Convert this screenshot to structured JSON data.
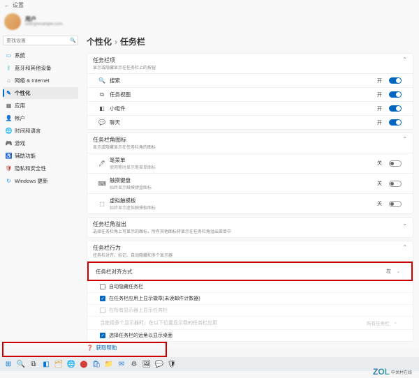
{
  "titlebar": {
    "back": "←",
    "title": "设置"
  },
  "profile": {
    "name": "用户",
    "email": "user@example.com"
  },
  "search": {
    "placeholder": "查找设置"
  },
  "nav": [
    {
      "icon": "▭",
      "iconClass": "c-blue",
      "label": "系统"
    },
    {
      "icon": "ᛒ",
      "iconClass": "c-cyan",
      "label": "蓝牙和其他设备"
    },
    {
      "icon": "⌂",
      "iconClass": "c-gray",
      "label": "网络 & Internet"
    },
    {
      "icon": "✎",
      "iconClass": "c-brush",
      "label": "个性化",
      "selected": true
    },
    {
      "icon": "▦",
      "iconClass": "c-grid",
      "label": "应用"
    },
    {
      "icon": "👤",
      "iconClass": "c-orange",
      "label": "帐户"
    },
    {
      "icon": "🌐",
      "iconClass": "c-green",
      "label": "时间和语言"
    },
    {
      "icon": "🎮",
      "iconClass": "c-gold",
      "label": "游戏"
    },
    {
      "icon": "♿",
      "iconClass": "c-navy",
      "label": "辅助功能"
    },
    {
      "icon": "🛡",
      "iconClass": "c-red",
      "label": "隐私和安全性"
    },
    {
      "icon": "↻",
      "iconClass": "c-blue",
      "label": "Windows 更新"
    }
  ],
  "breadcrumb": {
    "parent": "个性化",
    "sep": "›",
    "current": "任务栏"
  },
  "sections": {
    "items": {
      "title": "任务栏项",
      "subtitle": "显示或隐藏显示在任务栏上的按钮",
      "rows": [
        {
          "icon": "🔍",
          "label": "搜索",
          "state": "开",
          "on": true
        },
        {
          "icon": "⧉",
          "label": "任务视图",
          "state": "开",
          "on": true
        },
        {
          "icon": "◧",
          "label": "小组件",
          "state": "开",
          "on": true,
          "iconClass": "i-widget"
        },
        {
          "icon": "💬",
          "label": "聊天",
          "state": "开",
          "on": true
        }
      ]
    },
    "corner": {
      "title": "任务栏角图标",
      "subtitle": "显示或隐藏显示在任务栏角的图标",
      "rows": [
        {
          "icon": "🖊",
          "label": "笔菜单",
          "sub": "使用笔时显示笔菜单图标",
          "state": "关",
          "on": false
        },
        {
          "icon": "⌨",
          "label": "触摸键盘",
          "sub": "始终显示触摸键盘图标",
          "state": "关",
          "on": false
        },
        {
          "icon": "⬚",
          "label": "虚拟触摸板",
          "sub": "始终显示虚拟触摸板图标",
          "state": "关",
          "on": false
        }
      ]
    },
    "overflow": {
      "title": "任务栏角溢出",
      "subtitle": "选择任务栏角上可显示的图标，所有其他图标将显示在任务栏角溢出菜单中"
    },
    "behavior": {
      "title": "任务栏行为",
      "subtitle": "任务栏对齐、标记、自动隐藏和多个显示器",
      "alignment": {
        "label": "任务栏对齐方式",
        "value": "左"
      },
      "checks": [
        {
          "checked": false,
          "label": "自动隐藏任务栏",
          "disabled": false
        },
        {
          "checked": true,
          "label": "在任务栏应用上显示徽章(未读邮件计数器)",
          "disabled": false
        },
        {
          "checked": false,
          "label": "在所有显示器上显示任务栏",
          "disabled": true
        },
        {
          "label": "当使用多个显示器时，在以下位置显示我的任务栏应用",
          "dropdown": "所有任务栏",
          "disabled": true
        },
        {
          "checked": true,
          "label": "选择任务栏的远角以显示桌面",
          "disabled": false
        }
      ]
    }
  },
  "help": {
    "icon": "❓",
    "label": "获取帮助"
  },
  "taskbar": [
    {
      "icon": "⊞",
      "cls": "tb-start",
      "name": "start"
    },
    {
      "icon": "🔍",
      "cls": "",
      "name": "search"
    },
    {
      "icon": "⧉",
      "cls": "",
      "name": "task-view"
    },
    {
      "icon": "◧",
      "cls": "tb-start",
      "name": "widgets"
    },
    {
      "icon": "🗂",
      "cls": "tb-explorer",
      "name": "explorer"
    },
    {
      "icon": "🌐",
      "cls": "tb-edge",
      "name": "edge"
    },
    {
      "icon": "⬤",
      "cls": "tb-chrome",
      "name": "chrome"
    },
    {
      "icon": "🛍",
      "cls": "tb-store",
      "name": "store"
    },
    {
      "icon": "📁",
      "cls": "tb-folder",
      "name": "folder"
    },
    {
      "icon": "✉",
      "cls": "tb-mail",
      "name": "mail"
    },
    {
      "icon": "⚙",
      "cls": "tb-settings",
      "name": "settings"
    },
    {
      "icon": "🖼",
      "cls": "",
      "name": "photos"
    },
    {
      "icon": "💬",
      "cls": "",
      "name": "chat"
    },
    {
      "icon": "🛡",
      "cls": "",
      "name": "security"
    }
  ],
  "watermark": {
    "brand": "ZOL",
    "cn": "中关村在线"
  }
}
